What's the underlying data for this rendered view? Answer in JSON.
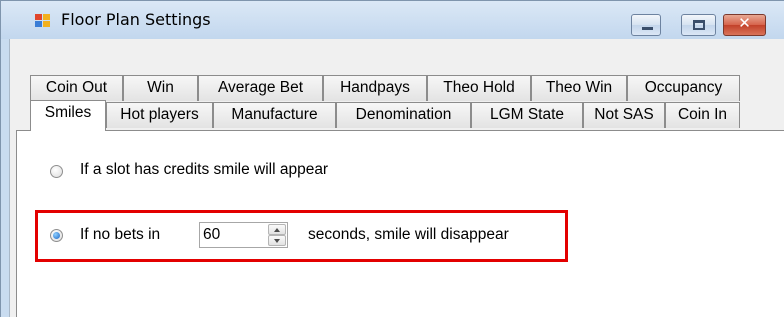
{
  "window": {
    "title": "Floor Plan Settings",
    "icon": "floor-plan-app-icon",
    "controls": {
      "minimize": "minimize-icon",
      "maximize": "maximize-icon",
      "close": "close-icon"
    }
  },
  "tabs": {
    "row1": [
      "Coin Out",
      "Win",
      "Average Bet",
      "Handpays",
      "Theo Hold",
      "Theo Win",
      "Occupancy"
    ],
    "row2": [
      "Smiles",
      "Hot players",
      "Manufacture",
      "Denomination",
      "LGM State",
      "Not SAS",
      "Coin In"
    ],
    "selected": "Smiles"
  },
  "smiles": {
    "option_credits_label": "If a slot has credits smile will appear",
    "option_credits_checked": false,
    "option_nobets_prefix": "If no bets in",
    "option_nobets_checked": true,
    "seconds_value": "60",
    "option_nobets_suffix": "seconds, smile will disappear"
  },
  "colors": {
    "highlight_border": "#e30000",
    "titlebar": "#c9dcf0",
    "selected_radio": "#1a64c4"
  }
}
